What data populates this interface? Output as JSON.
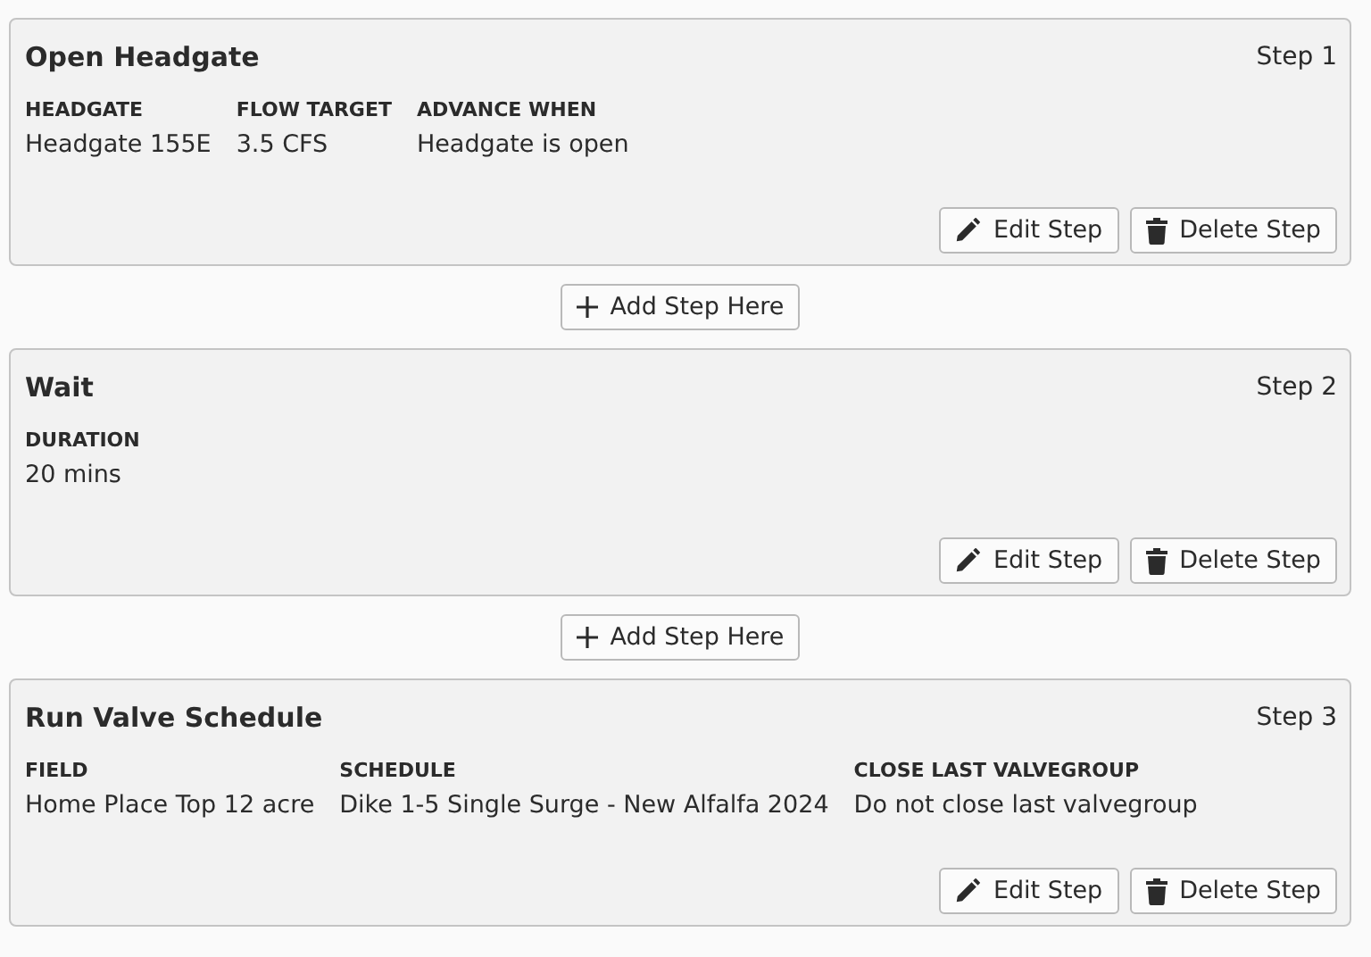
{
  "steps": [
    {
      "title": "Open Headgate",
      "step_label": "Step 1",
      "fields": [
        {
          "label": "HEADGATE",
          "value": "Headgate 155E"
        },
        {
          "label": "FLOW TARGET",
          "value": "3.5 CFS"
        },
        {
          "label": "ADVANCE WHEN",
          "value": "Headgate is open"
        }
      ],
      "edit_button": "Edit Step",
      "delete_button": "Delete Step",
      "add_button": "Add Step Here"
    },
    {
      "title": "Wait",
      "step_label": "Step 2",
      "fields": [
        {
          "label": "DURATION",
          "value": "20 mins"
        }
      ],
      "edit_button": "Edit Step",
      "delete_button": "Delete Step",
      "add_button": "Add Step Here"
    },
    {
      "title": "Run Valve Schedule",
      "step_label": "Step 3",
      "fields": [
        {
          "label": "FIELD",
          "value": "Home Place Top 12 acre"
        },
        {
          "label": "SCHEDULE",
          "value": "Dike 1-5 Single Surge - New Alfalfa 2024"
        },
        {
          "label": "CLOSE LAST VALVEGROUP",
          "value": "Do not close last valvegroup"
        }
      ],
      "edit_button": "Edit Step",
      "delete_button": "Delete Step"
    }
  ]
}
